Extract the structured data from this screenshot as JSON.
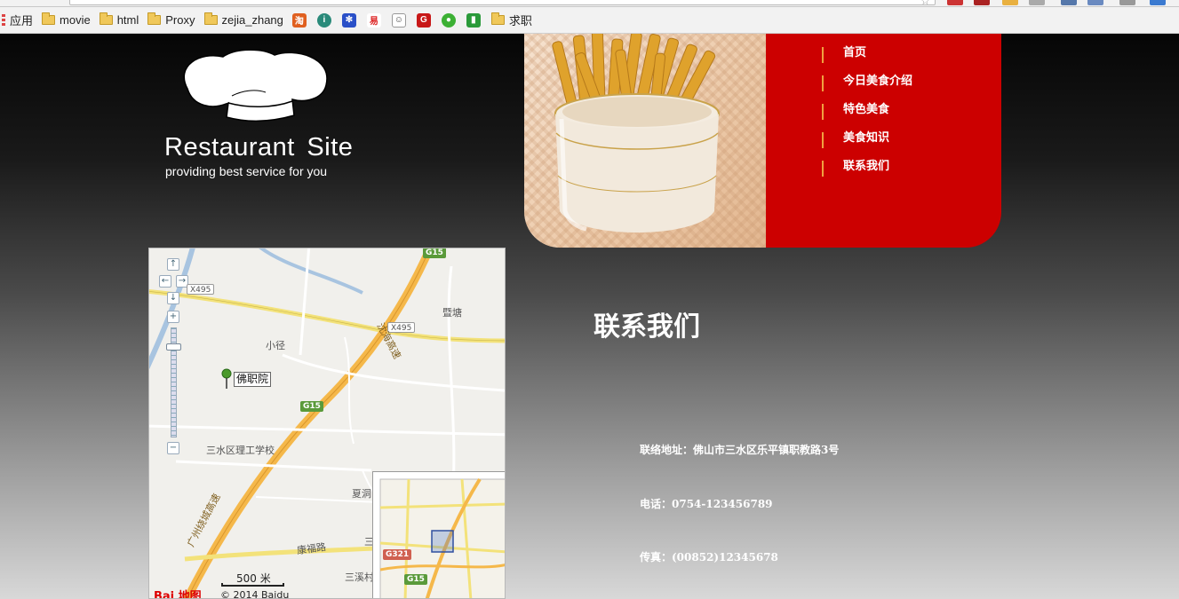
{
  "bookmarks": {
    "items": [
      {
        "label": "应用"
      },
      {
        "label": "movie"
      },
      {
        "label": "html"
      },
      {
        "label": "Proxy"
      },
      {
        "label": "zejia_zhang"
      },
      {
        "label": "求职"
      }
    ]
  },
  "site": {
    "title": "Restaurant  Site",
    "tagline": "providing best service for you"
  },
  "nav": {
    "items": [
      {
        "label": "首页"
      },
      {
        "label": "今日美食介绍"
      },
      {
        "label": "特色美食"
      },
      {
        "label": "美食知识"
      },
      {
        "label": "联系我们"
      }
    ]
  },
  "map": {
    "place_labels": {
      "xiaojing": "小径",
      "jitang": "暨塘",
      "school": "三水区理工学校",
      "xiadong": "夏洞",
      "sanxi": "三溪村",
      "kangfu_road": "康福路",
      "san": "三"
    },
    "road_labels": {
      "g15_top": "G15",
      "g15_mid": "G15",
      "x495_left": "X495",
      "x495_right": "X495",
      "expressway": "广州绕城高速",
      "expressway_short": "沈海高速"
    },
    "pin_label": "佛职院",
    "overview_labels": {
      "g321": "G321",
      "g15": "G15"
    },
    "scale": "500 米",
    "logo_text": "Bai 地图",
    "copyright": "© 2014 Baidu"
  },
  "contact": {
    "heading": "联系我们",
    "address": "联络地址：佛山市三水区乐平镇职教路3号",
    "phone": "电话：0754-123456789",
    "fax": "传真：(00852)12345678"
  },
  "colors": {
    "nav_background": "#cc0000",
    "nav_divider": "#f0a040",
    "text": "#ffffff"
  }
}
